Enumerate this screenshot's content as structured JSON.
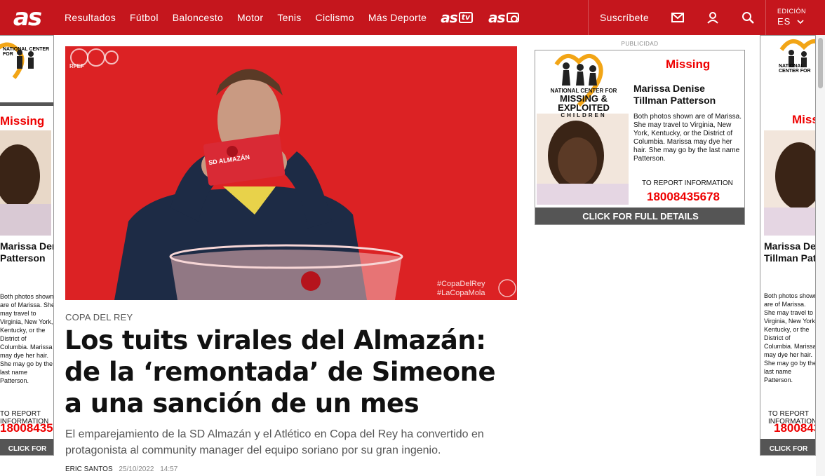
{
  "nav": {
    "logo": "as",
    "items": [
      "Resultados",
      "Fútbol",
      "Baloncesto",
      "Motor",
      "Tenis",
      "Ciclismo",
      "Más Deporte"
    ],
    "brand_tv": "as",
    "brand_tv_badge": "tv",
    "brand_photo": "as",
    "subscribe": "Suscríbete",
    "edition_label": "EDICIÓN",
    "edition_value": "ES",
    "icons": [
      "mail-icon",
      "user-icon",
      "search-icon",
      "chevron-down-icon"
    ]
  },
  "article": {
    "section": "COPA DEL REY",
    "headline": "Los tuits virales del Almazán: de la ‘remontada’ de Simeone a una sanción de un mes",
    "lede": "El emparejamiento de la SD Almazán y el Atlético en Copa del Rey ha convertido en protagonista al community manager del equipo soriano por su gran ingenio.",
    "author": "ERIC SANTOS",
    "date": "25/10/2022",
    "time": "14:57",
    "image": {
      "card_text": "SD ALMAZÁN",
      "federation": "RFEF",
      "hashtag1": "#CopaDelRey",
      "hashtag2": "#LaCopaMola"
    }
  },
  "ads": {
    "label": "PUBLICIDAD",
    "org_line1": "NATIONAL CENTER FOR",
    "org_line2": "MISSING &",
    "org_line3": "EXPLOITED",
    "org_line4": "CHILDREN",
    "missing": "Missing",
    "name": "Marissa Denise Tillman Patterson",
    "desc": "Both photos shown are of Marissa. She may travel to Virginia, New York, Kentucky, or the District of Columbia. Marissa may dye her hair. She may go by the last name Patterson.",
    "report": "TO REPORT INFORMATION",
    "phone": "18008435678",
    "cta": "CLICK FOR FULL DETAILS"
  },
  "colors": {
    "brand_red": "#c5161d",
    "ad_red": "#e00000"
  }
}
